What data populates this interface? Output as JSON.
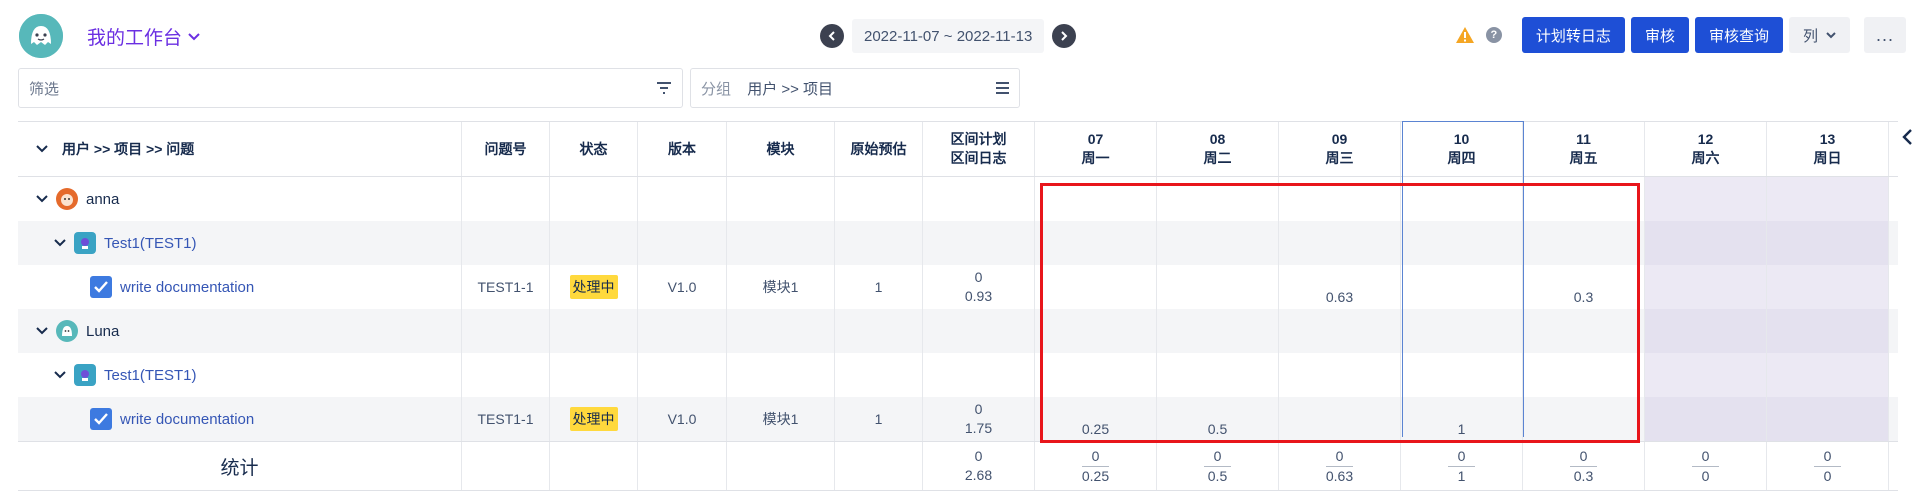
{
  "header": {
    "title": "我的工作台",
    "date_range": "2022-11-07 ~ 2022-11-13",
    "buttons": {
      "plan_to_log": "计划转日志",
      "review": "审核",
      "review_query": "审核查询",
      "columns": "列",
      "more": "..."
    }
  },
  "filter": {
    "placeholder": "筛选"
  },
  "group": {
    "label": "分组",
    "value": "用户 >> 项目"
  },
  "table": {
    "headers": {
      "tree": "用户 >> 项目 >> 问题",
      "issue_key": "问题号",
      "status": "状态",
      "version": "版本",
      "module": "模块",
      "original_estimate": "原始预估",
      "range_plan": "区间计划",
      "range_log": "区间日志"
    },
    "days": [
      {
        "num": "07",
        "week": "周一"
      },
      {
        "num": "08",
        "week": "周二"
      },
      {
        "num": "09",
        "week": "周三"
      },
      {
        "num": "10",
        "week": "周四"
      },
      {
        "num": "11",
        "week": "周五"
      },
      {
        "num": "12",
        "week": "周六"
      },
      {
        "num": "13",
        "week": "周日"
      }
    ],
    "users": [
      {
        "name": "anna",
        "project": "Test1(TEST1)",
        "issue": {
          "summary": "write documentation",
          "key": "TEST1-1",
          "status": "处理中",
          "version": "V1.0",
          "module": "模块1",
          "estimate": "1",
          "plan": "0",
          "log": "0.93",
          "days": [
            "",
            "",
            "0.63",
            "",
            "0.3",
            "",
            ""
          ]
        }
      },
      {
        "name": "Luna",
        "project": "Test1(TEST1)",
        "issue": {
          "summary": "write documentation",
          "key": "TEST1-1",
          "status": "处理中",
          "version": "V1.0",
          "module": "模块1",
          "estimate": "1",
          "plan": "0",
          "log": "1.75",
          "days": [
            "0.25",
            "0.5",
            "",
            "1",
            "",
            "",
            ""
          ]
        }
      }
    ],
    "totals": {
      "label": "统计",
      "plan": "0",
      "log": "2.68",
      "days": [
        {
          "plan": "0",
          "log": "0.25"
        },
        {
          "plan": "0",
          "log": "0.5"
        },
        {
          "plan": "0",
          "log": "0.63"
        },
        {
          "plan": "0",
          "log": "1"
        },
        {
          "plan": "0",
          "log": "0.3"
        },
        {
          "plan": "0",
          "log": "0"
        },
        {
          "plan": "0",
          "log": "0"
        }
      ]
    }
  },
  "colors": {
    "primary_button": "#1e4fd6",
    "title": "#6b2fe2",
    "status_badge": "#ffd93d",
    "highlight_box": "#e8151b",
    "weekend": "#ece9f4"
  }
}
